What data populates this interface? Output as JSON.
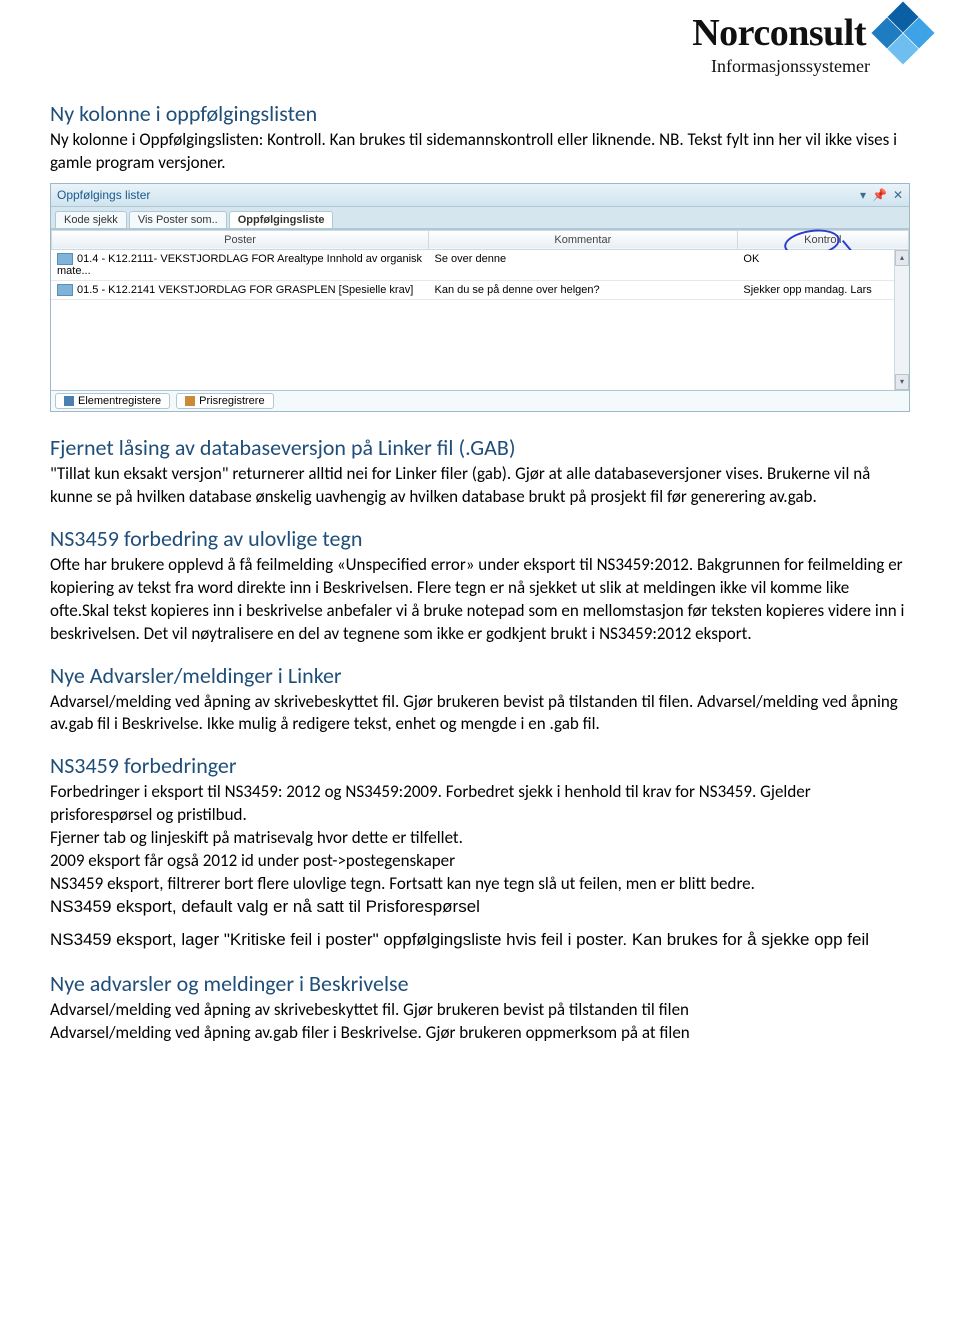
{
  "logo": {
    "name": "Norconsult",
    "sub": "Informasjonssystemer"
  },
  "sec1": {
    "heading": "Ny kolonne i oppfølgingslisten",
    "body": "Ny kolonne i Oppfølgingslisten: Kontroll. Kan brukes til sidemannskontroll eller liknende. NB. Tekst fylt inn her vil ikke vises i gamle program versjoner."
  },
  "screenshot": {
    "window_title": "Oppfølgings lister",
    "tabs": [
      "Kode sjekk",
      "Vis Poster som..",
      "Oppfølgingsliste"
    ],
    "active_tab": 2,
    "columns": [
      "Poster",
      "Kommentar",
      "Kontroll"
    ],
    "rows": [
      {
        "poster": "01.4 - K12.2111-  VEKSTJORDLAG FOR Arealtype  Innhold av organisk mate...",
        "kommentar": "Se over denne",
        "kontroll": "OK"
      },
      {
        "poster": "01.5 - K12.2141 VEKSTJORDLAG FOR GRASPLEN [Spesielle krav]",
        "kommentar": "Kan du se på denne over helgen?",
        "kontroll": "Sjekker opp mandag. Lars"
      }
    ],
    "bottom_tabs": [
      "Elementregistere",
      "Prisregistrere"
    ]
  },
  "sec2": {
    "heading": "Fjernet låsing av databaseversjon på Linker fil (.GAB)",
    "body": "\"Tillat kun eksakt versjon\" returnerer alltid nei for Linker filer (gab). Gjør at alle databaseversjoner vises. Brukerne vil nå kunne se på hvilken database ønskelig uavhengig av hvilken database brukt på prosjekt fil før generering av.gab."
  },
  "sec3": {
    "heading": "NS3459 forbedring av ulovlige tegn",
    "body": "Ofte har brukere opplevd å få feilmelding «Unspecified error» under eksport til NS3459:2012. Bakgrunnen for feilmelding er kopiering av tekst fra word direkte inn i Beskrivelsen. Flere tegn er nå sjekket ut slik at meldingen ikke vil komme like ofte.Skal tekst kopieres inn i beskrivelse anbefaler vi å bruke notepad som en mellomstasjon før teksten kopieres videre inn i beskrivelsen. Det vil nøytralisere en del av tegnene som ikke er godkjent brukt i NS3459:2012 eksport."
  },
  "sec4": {
    "heading": "Nye Advarsler/meldinger i Linker",
    "body": "Advarsel/melding ved åpning av skrivebeskyttet fil. Gjør brukeren bevist på tilstanden til filen. Advarsel/melding ved åpning av.gab fil i Beskrivelse. Ikke mulig å redigere tekst, enhet og mengde i en .gab fil."
  },
  "sec5": {
    "heading": "NS3459 forbedringer",
    "p1": "Forbedringer i eksport til NS3459: 2012 og NS3459:2009. Forbedret sjekk i henhold til krav for NS3459. Gjelder prisforespørsel og pristilbud.",
    "p2": "Fjerner tab og linjeskift på matrisevalg hvor dette er tilfellet.",
    "p3": "2009 eksport får også 2012 id under post->postegenskaper",
    "p4": "NS3459 eksport, filtrerer bort flere ulovlige tegn. Fortsatt kan nye tegn slå ut feilen, men er blitt bedre.",
    "p5": "NS3459 eksport, default valg er nå satt til Prisforespørsel",
    "p6": "NS3459 eksport, lager \"Kritiske feil i poster\" oppfølgingsliste hvis feil i poster. Kan brukes for å sjekke opp feil"
  },
  "sec6": {
    "heading": "Nye advarsler og meldinger i Beskrivelse",
    "p1": "Advarsel/melding ved åpning av skrivebeskyttet fil. Gjør brukeren bevist på tilstanden til filen",
    "p2": "Advarsel/melding ved åpning av.gab filer i Beskrivelse. Gjør brukeren oppmerksom på at filen"
  }
}
